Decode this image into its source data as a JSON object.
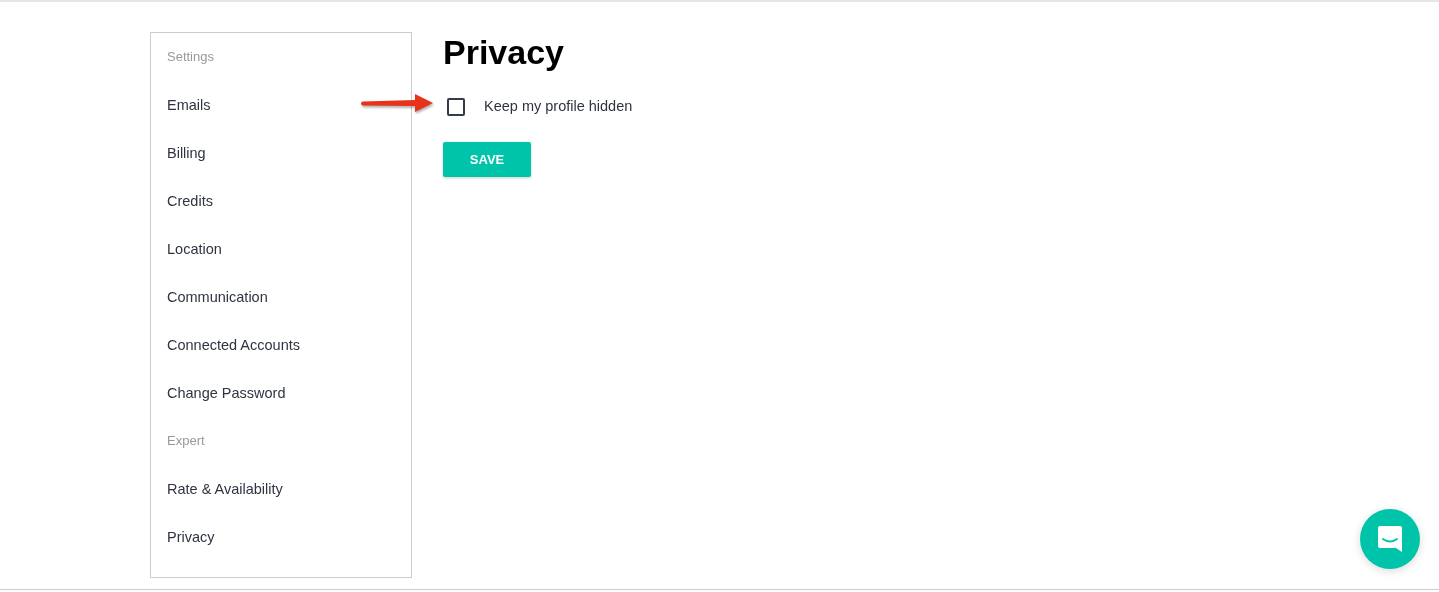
{
  "sidebar": {
    "sections": [
      {
        "heading": "Settings",
        "items": [
          "Emails",
          "Billing",
          "Credits",
          "Location",
          "Communication",
          "Connected Accounts",
          "Change Password"
        ]
      },
      {
        "heading": "Expert",
        "items": [
          "Rate & Availability",
          "Privacy"
        ]
      }
    ]
  },
  "page": {
    "title": "Privacy",
    "options": [
      {
        "label": "Keep my profile hidden",
        "checked": false
      }
    ],
    "save_button": "SAVE"
  }
}
